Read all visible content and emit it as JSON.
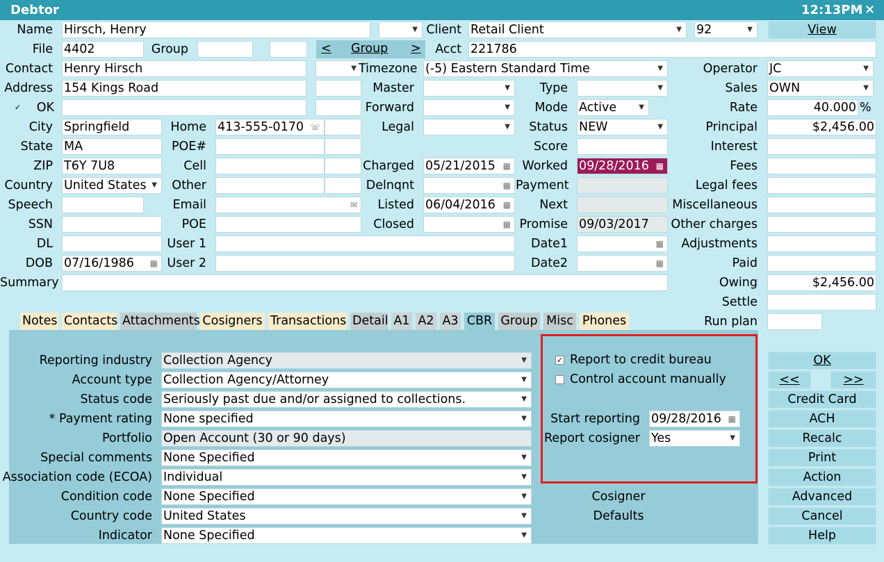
{
  "window": {
    "title": "Debtor",
    "clock": "12:13PM",
    "close": "×"
  },
  "left": {
    "name_label": "Name",
    "name": "Hirsch, Henry",
    "client_label": "Client",
    "client": "Retail Client",
    "client_code": "92",
    "view": "View",
    "file_label": "File",
    "file": "4402",
    "group_label": "Group",
    "group_nav": "Group",
    "prev": "<",
    "next": ">",
    "acct_label": "Acct",
    "acct": "221786",
    "contact_label": "Contact",
    "contact": "Henry Hirsch",
    "timezone_label": "Timezone",
    "timezone": "(-5) Eastern Standard Time",
    "address_label": "Address",
    "address": "154 Kings Road",
    "master_label": "Master",
    "ok_label": "OK",
    "forward_label": "Forward",
    "city_label": "City",
    "city": "Springfield",
    "home_label": "Home",
    "home": "413-555-0170",
    "legal_label": "Legal",
    "state_label": "State",
    "state": "MA",
    "poe_num_label": "POE#",
    "zip_label": "ZIP",
    "zip": "T6Y 7U8",
    "cell_label": "Cell",
    "charged_label": "Charged",
    "charged": "05/21/2015",
    "country_label": "Country",
    "country": "United States",
    "other_label": "Other",
    "delnqnt_label": "Delnqnt",
    "speech_label": "Speech",
    "email_label": "Email",
    "listed_label": "Listed",
    "listed": "06/04/2016",
    "ssn_label": "SSN",
    "poe_label": "POE",
    "closed_label": "Closed",
    "dl_label": "DL",
    "user1_label": "User 1",
    "dob_label": "DOB",
    "dob": "07/16/1986",
    "user2_label": "User 2",
    "summary_label": "Summary"
  },
  "mid": {
    "type_label": "Type",
    "mode_label": "Mode",
    "mode": "Active",
    "status_label": "Status",
    "status": "NEW",
    "score_label": "Score",
    "worked_label": "Worked",
    "worked": "09/28/2016",
    "payment_label": "Payment",
    "next_label": "Next",
    "promise_label": "Promise",
    "promise": "09/03/2017",
    "date1_label": "Date1",
    "date2_label": "Date2"
  },
  "right": {
    "operator_label": "Operator",
    "operator": "JC",
    "sales_label": "Sales",
    "sales": "OWN",
    "rate_label": "Rate",
    "rate": "40.000",
    "rate_unit": "%",
    "principal_label": "Principal",
    "principal": "$2,456.00",
    "interest_label": "Interest",
    "fees_label": "Fees",
    "legal_fees_label": "Legal fees",
    "misc_label": "Miscellaneous",
    "other_charges_label": "Other charges",
    "adjustments_label": "Adjustments",
    "paid_label": "Paid",
    "owing_label": "Owing",
    "owing": "$2,456.00",
    "settle_label": "Settle",
    "run_plan_label": "Run plan"
  },
  "tabs": [
    "Notes",
    "Contacts",
    "Attachments",
    "Cosigners",
    "Transactions",
    "Detail",
    "A1",
    "A2",
    "A3",
    "CBR",
    "Group",
    "Misc",
    "Phones"
  ],
  "cbr": {
    "industry_label": "Reporting industry",
    "industry": "Collection Agency",
    "account_type_label": "Account type",
    "account_type": "Collection Agency/Attorney",
    "status_code_label": "Status code",
    "status_code": "Seriously past due and/or assigned to collections.",
    "payment_rating_label": "* Payment rating",
    "payment_rating": "None specified",
    "portfolio_label": "Portfolio",
    "portfolio": "Open Account (30 or 90 days)",
    "special_comments_label": "Special comments",
    "special_comments": "None Specified",
    "ecoa_label": "Association code (ECOA)",
    "ecoa": "Individual",
    "condition_label": "Condition code",
    "condition": "None Specified",
    "country_code_label": "Country code",
    "country_code": "United States",
    "indicator_label": "Indicator",
    "indicator": "None Specified",
    "report_credit_label": "Report to credit bureau",
    "report_credit": true,
    "control_manual_label": "Control account manually",
    "control_manual": false,
    "start_reporting_label": "Start reporting",
    "start_reporting": "09/28/2016",
    "report_cosigner_label": "Report cosigner",
    "report_cosigner": "Yes",
    "cosigner_link": "Cosigner",
    "defaults_link": "Defaults"
  },
  "buttons": {
    "ok": "OK",
    "prev": "<<",
    "next": ">>",
    "credit_card": "Credit Card",
    "ach": "ACH",
    "recalc": "Recalc",
    "print": "Print",
    "action": "Action",
    "advanced": "Advanced",
    "cancel": "Cancel",
    "help": "Help"
  },
  "colors": {
    "titlebar": "#2e9cb1",
    "background": "#c6ebf2",
    "panel": "#96ccd8",
    "highlight": "#9d1a58",
    "redbox": "#e02020"
  }
}
